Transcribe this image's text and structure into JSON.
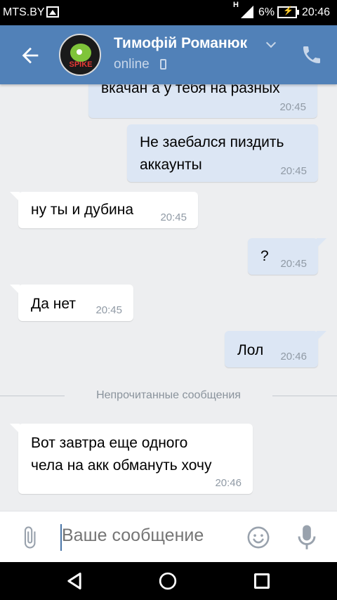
{
  "status_bar": {
    "carrier": "MTS.BY",
    "network": "H",
    "battery": "6%",
    "time": "20:46"
  },
  "header": {
    "name": "Тимофій Романюк",
    "status": "online",
    "avatar_text": "SPIKE"
  },
  "messages": [
    {
      "direction": "out",
      "text": "вкачан а у тебя на разных",
      "time": "20:45"
    },
    {
      "direction": "out",
      "text_lines": [
        "Не заебался пиздить",
        "аккаунты"
      ],
      "time": "20:45"
    },
    {
      "direction": "in",
      "text": "ну ты и дубина",
      "time": "20:45"
    },
    {
      "direction": "out",
      "text": "?",
      "time": "20:45"
    },
    {
      "direction": "in",
      "text": "Да нет",
      "time": "20:45"
    },
    {
      "direction": "out",
      "text": "Лол",
      "time": "20:46"
    },
    {
      "direction": "in",
      "text_lines": [
        "Вот завтра еще одного",
        "чела на акк обмануть хочу"
      ],
      "time": "20:46"
    }
  ],
  "unread_divider": "Непрочитанные сообщения",
  "composer": {
    "placeholder": "Ваше сообщение"
  },
  "colors": {
    "header": "#5181b8",
    "outgoing": "#dce6f4",
    "incoming": "#ffffff",
    "background": "#edeef0"
  }
}
